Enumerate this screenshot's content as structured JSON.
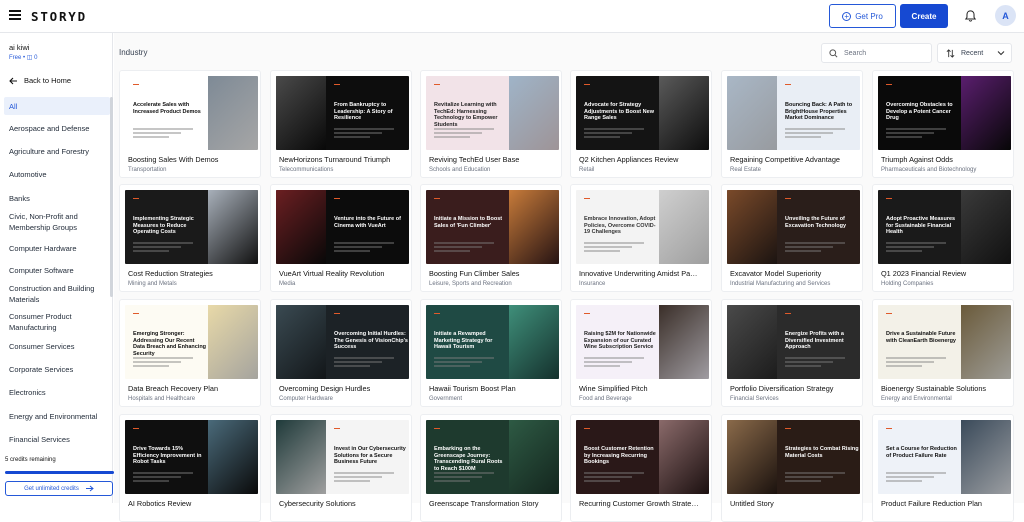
{
  "app": {
    "logo": "STORYD",
    "get_pro": "Get Pro",
    "create": "Create",
    "avatar": "A"
  },
  "sidebar": {
    "user": "ai kiwi",
    "plan": "Free • ◫ 0",
    "back": "Back to Home",
    "categories": [
      "All",
      "Aerospace and Defense",
      "Agriculture and Forestry",
      "Automotive",
      "Banks",
      "Civic, Non-Profit and Membership Groups",
      "Computer Hardware",
      "Computer Software",
      "Construction and Building Materials",
      "Consumer Product Manufacturing",
      "Consumer Services",
      "Corporate Services",
      "Electronics",
      "Energy and Environmental",
      "Financial Services"
    ],
    "credits": "5 credits remaining",
    "unlimited": "Get unlimited credits"
  },
  "main": {
    "title": "Industry",
    "search_placeholder": "Search",
    "sort": "Recent"
  },
  "cards": [
    {
      "title": "Boosting Sales With Demos",
      "sub": "Transportation",
      "slide": "Accelerate Sales with Increased Product Demos",
      "bg": "#ffffff",
      "fg": "#111111",
      "img": "#7e8a96"
    },
    {
      "title": "NewHorizons Turnaround Triumph",
      "sub": "Telecommunications",
      "slide": "From Bankruptcy to Leadership: A Story of Resilience",
      "bg": "#0d0d0d",
      "fg": "#ffffff",
      "img": "#4a4a4a"
    },
    {
      "title": "Reviving TechEd User Base",
      "sub": "Schools and Education",
      "slide": "Revitalize Learning with TechEd: Harnessing Technology to Empower Students",
      "bg": "#f2e3e8",
      "fg": "#222222",
      "img": "#9fb4c8"
    },
    {
      "title": "Q2 Kitchen Appliances Review",
      "sub": "Retail",
      "slide": "Advocate for Strategy Adjustments to Boost New Range Sales",
      "bg": "#141414",
      "fg": "#ffffff",
      "img": "#5a5a5a"
    },
    {
      "title": "Regaining Competitive Advantage",
      "sub": "Real Estate",
      "slide": "Bouncing Back: A Path to BrightHouse Properties Market Dominance",
      "bg": "#e9eef5",
      "fg": "#111111",
      "img": "#a9b7c6"
    },
    {
      "title": "Triumph Against Odds",
      "sub": "Pharmaceuticals and Biotechnology",
      "slide": "Overcoming Obstacles to Develop a Potent Cancer Drug",
      "bg": "#0a0a0a",
      "fg": "#ffffff",
      "img": "#5a1e6e"
    },
    {
      "title": "Cost Reduction Strategies",
      "sub": "Mining and Metals",
      "slide": "Implementing Strategic Measures to Reduce Operating Costs",
      "bg": "#1a1a1a",
      "fg": "#ffffff",
      "img": "#a8b0ba"
    },
    {
      "title": "VueArt Virtual Reality Revolution",
      "sub": "Media",
      "slide": "Venture into the Future of Cinema with VueArt",
      "bg": "#0c0c0c",
      "fg": "#ffffff",
      "img": "#6b1f22"
    },
    {
      "title": "Boosting Fun Climber Sales",
      "sub": "Leisure, Sports and Recreation",
      "slide": "Initiate a Mission to Boost Sales of 'Fun Climber'",
      "bg": "#3a1d1d",
      "fg": "#ffffff",
      "img": "#c77b3a"
    },
    {
      "title": "Innovative Underwriting Amidst Pa…",
      "sub": "Insurance",
      "slide": "Embrace Innovation, Adopt Policies, Overcome COVID-19 Challenges",
      "bg": "#f3f3f3",
      "fg": "#333333",
      "img": "#cfcfcf"
    },
    {
      "title": "Excavator Model Superiority",
      "sub": "Industrial Manufacturing and Services",
      "slide": "Unveiling the Future of Excavation Technology",
      "bg": "#2a1e1a",
      "fg": "#ffffff",
      "img": "#7a4a2a"
    },
    {
      "title": "Q1 2023 Financial Review",
      "sub": "Holding Companies",
      "slide": "Adopt Proactive Measures for Sustainable Financial Health",
      "bg": "#1a1a1a",
      "fg": "#ffffff",
      "img": "#3a3a3a"
    },
    {
      "title": "Data Breach Recovery Plan",
      "sub": "Hospitals and Healthcare",
      "slide": "Emerging Stronger: Addressing Our Recent Data Breach and Enhancing Security",
      "bg": "#fdfbf3",
      "fg": "#111111",
      "img": "#e8d9a8"
    },
    {
      "title": "Overcoming Design Hurdles",
      "sub": "Computer Hardware",
      "slide": "Overcoming Initial Hurdles: The Genesis of VisionChip's Success",
      "bg": "#1c2226",
      "fg": "#ffffff",
      "img": "#3a4a52"
    },
    {
      "title": "Hawaii Tourism Boost Plan",
      "sub": "Government",
      "slide": "Initiate a Revamped Marketing Strategy for Hawaii Tourism",
      "bg": "#1f4a44",
      "fg": "#ffffff",
      "img": "#3f8f7a"
    },
    {
      "title": "Wine Simplified Pitch",
      "sub": "Food and Beverage",
      "slide": "Raising $2M for Nationwide Expansion of our Curated Wine Subscription Service",
      "bg": "#f5f0f8",
      "fg": "#222222",
      "img": "#3a2e28"
    },
    {
      "title": "Portfolio Diversification Strategy",
      "sub": "Financial Services",
      "slide": "Energize Profits with a Diversified Investment Approach",
      "bg": "#2b2b2b",
      "fg": "#ffffff",
      "img": "#4a4a4a"
    },
    {
      "title": "Bioenergy Sustainable Solutions",
      "sub": "Energy and Environmental",
      "slide": "Drive a Sustainable Future with CleanEarth Bioenergy",
      "bg": "#f3f1e8",
      "fg": "#111111",
      "img": "#6a5a3a"
    },
    {
      "title": "AI Robotics Review",
      "sub": "",
      "slide": "Drive Towards 15% Efficiency Improvement in Robot Tasks",
      "bg": "#0f0f0f",
      "fg": "#ffffff",
      "img": "#4a6a7a"
    },
    {
      "title": "Cybersecurity Solutions",
      "sub": "",
      "slide": "Invest in Our Cybersecurity Solutions for a Secure Business Future",
      "bg": "#f4f4f4",
      "fg": "#111111",
      "img": "#1f3a3a"
    },
    {
      "title": "Greenscape Transformation Story",
      "sub": "",
      "slide": "Embarking on the Greenscape Journey: Transcending Rural Roots to Reach $100M",
      "bg": "#1e3a2e",
      "fg": "#ffffff",
      "img": "#2e5a44"
    },
    {
      "title": "Recurring Customer Growth Strate…",
      "sub": "",
      "slide": "Boost Customer Retention by Increasing Recurring Bookings",
      "bg": "#2a1818",
      "fg": "#ffffff",
      "img": "#8a6a6a"
    },
    {
      "title": "Untitled Story",
      "sub": "",
      "slide": "Strategies to Combat Rising Material Costs",
      "bg": "#2a1c16",
      "fg": "#ffffff",
      "img": "#8a6a4a"
    },
    {
      "title": "Product Failure Reduction Plan",
      "sub": "",
      "slide": "Set a Course for Reduction of Product Failure Rate",
      "bg": "#eef2f8",
      "fg": "#111111",
      "img": "#3a4a5a"
    }
  ]
}
